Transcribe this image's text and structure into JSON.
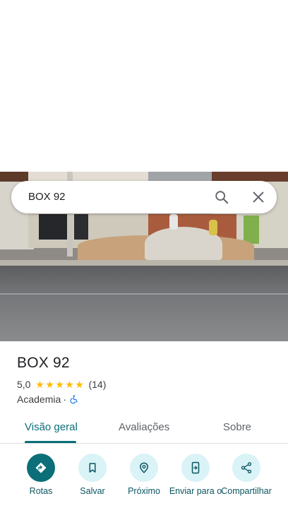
{
  "search": {
    "query": "BOX 92"
  },
  "place": {
    "name": "BOX 92",
    "rating": "5,0",
    "stars": 5,
    "review_count": "(14)",
    "category": "Academia",
    "separator": "·"
  },
  "tabs": [
    {
      "label": "Visão geral",
      "active": true
    },
    {
      "label": "Avaliações",
      "active": false
    },
    {
      "label": "Sobre",
      "active": false
    }
  ],
  "actions": [
    {
      "label": "Rotas",
      "icon": "directions-icon"
    },
    {
      "label": "Salvar",
      "icon": "bookmark-icon"
    },
    {
      "label": "Próximo",
      "icon": "nearby-icon"
    },
    {
      "label": "Enviar para o",
      "icon": "send-to-phone-icon"
    },
    {
      "label": "Compartilhar",
      "icon": "share-icon"
    }
  ],
  "colors": {
    "accent": "#0b6e78",
    "action_bg": "#d9f3f7",
    "star": "#fbbc04"
  }
}
